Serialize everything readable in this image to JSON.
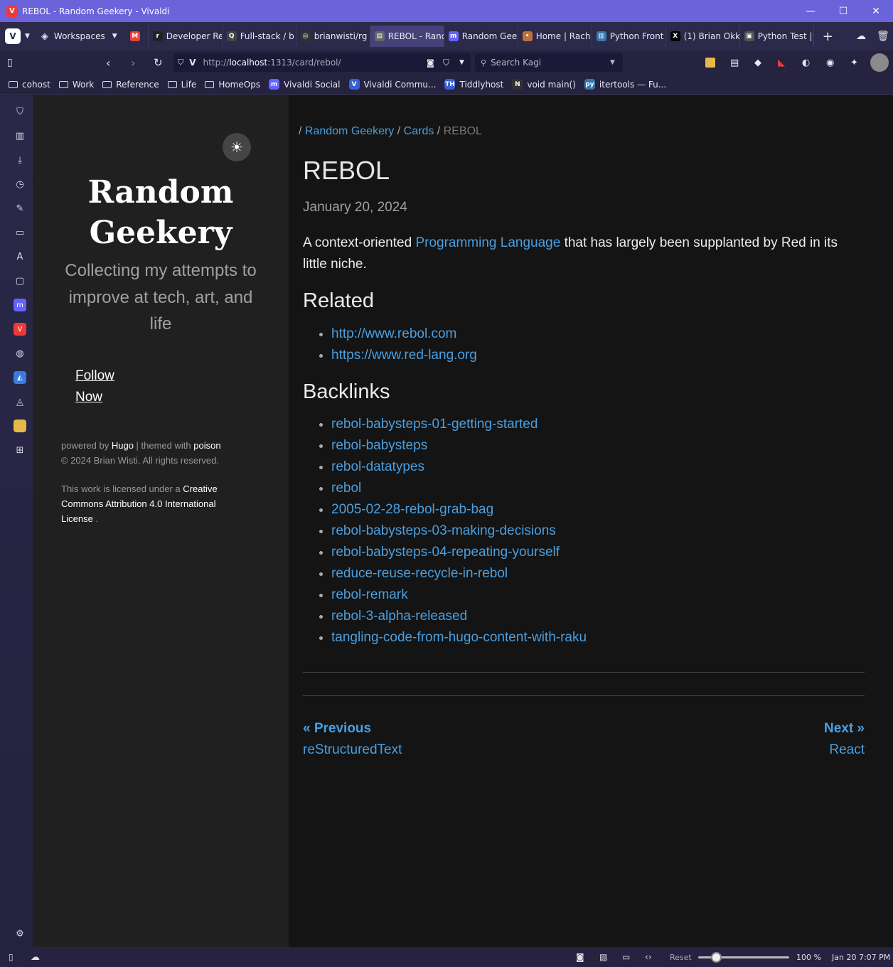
{
  "window": {
    "title": "REBOL - Random Geekery - Vivaldi"
  },
  "tabbar": {
    "workspaces_label": "Workspaces",
    "tabs": [
      {
        "label": "",
        "fav": "gmail"
      },
      {
        "label": "Developer Re",
        "fav": "r"
      },
      {
        "label": "Full-stack / b",
        "fav": "q"
      },
      {
        "label": "brianwisti/rg",
        "fav": "gh"
      },
      {
        "label": "REBOL - Rand",
        "fav": "doc",
        "active": true
      },
      {
        "label": "Random Gee",
        "fav": "m"
      },
      {
        "label": "Home | Rach",
        "fav": "pin"
      },
      {
        "label": "Python Front",
        "fav": "py"
      },
      {
        "label": "(1) Brian Okk",
        "fav": "x",
        "badge": "1"
      },
      {
        "label": "Python Test |",
        "fav": "pt"
      }
    ]
  },
  "addressbar": {
    "url_prefix": "http://",
    "url_host": "localhost",
    "url_rest": ":1313/card/rebol/",
    "search_placeholder": "Search Kagi"
  },
  "bookmarks": [
    {
      "label": "cohost",
      "type": "folder"
    },
    {
      "label": "Work",
      "type": "folder"
    },
    {
      "label": "Reference",
      "type": "folder"
    },
    {
      "label": "Life",
      "type": "folder"
    },
    {
      "label": "HomeOps",
      "type": "folder"
    },
    {
      "label": "Vivaldi Social",
      "type": "mastodon"
    },
    {
      "label": "Vivaldi Commu...",
      "type": "vivaldi"
    },
    {
      "label": "Tiddlyhost",
      "type": "tiddly"
    },
    {
      "label": "void main()",
      "type": "notion"
    },
    {
      "label": "itertools — Fu...",
      "type": "python"
    }
  ],
  "site": {
    "title_line1": "Random",
    "title_line2": "Geekery",
    "subtitle": "Collecting my attempts to improve at tech, art, and life",
    "follow_line1": "Follow",
    "follow_line2": "Now",
    "powered_by": "powered by",
    "hugo": "Hugo",
    "themed_with": "| themed with",
    "poison": "poison",
    "copyright": "© 2024 Brian Wisti. All rights reserved.",
    "license_prefix": "This work is licensed under a",
    "license_name": "Creative Commons Attribution 4.0 International License",
    "license_suffix": "."
  },
  "breadcrumb": {
    "sep": "/",
    "home": "Random Geekery",
    "section": "Cards",
    "current": "REBOL"
  },
  "article": {
    "title": "REBOL",
    "date": "January 20, 2024",
    "intro_before": "A context-oriented",
    "intro_link": "Programming Language",
    "intro_after": "that has largely been supplanted by Red in its little niche.",
    "related_heading": "Related",
    "related": [
      "http://www.rebol.com",
      "https://www.red-lang.org"
    ],
    "backlinks_heading": "Backlinks",
    "backlinks": [
      "rebol-babysteps-01-getting-started",
      "rebol-babysteps",
      "rebol-datatypes",
      "rebol",
      "2005-02-28-rebol-grab-bag",
      "rebol-babysteps-03-making-decisions",
      "rebol-babysteps-04-repeating-yourself",
      "reduce-reuse-recycle-in-rebol",
      "rebol-remark",
      "rebol-3-alpha-released",
      "tangling-code-from-hugo-content-with-raku"
    ]
  },
  "pager": {
    "prev_label": "« Previous",
    "prev_title": "reStructuredText",
    "next_label": "Next »",
    "next_title": "React"
  },
  "statusbar": {
    "reset_label": "Reset",
    "zoom": "100 %",
    "clock": "Jan 20 7:07 PM"
  },
  "colors": {
    "titlebar": "#6b63d9",
    "link": "#4a9fe0",
    "sidebar": "#202020",
    "content_bg": "#141414"
  }
}
